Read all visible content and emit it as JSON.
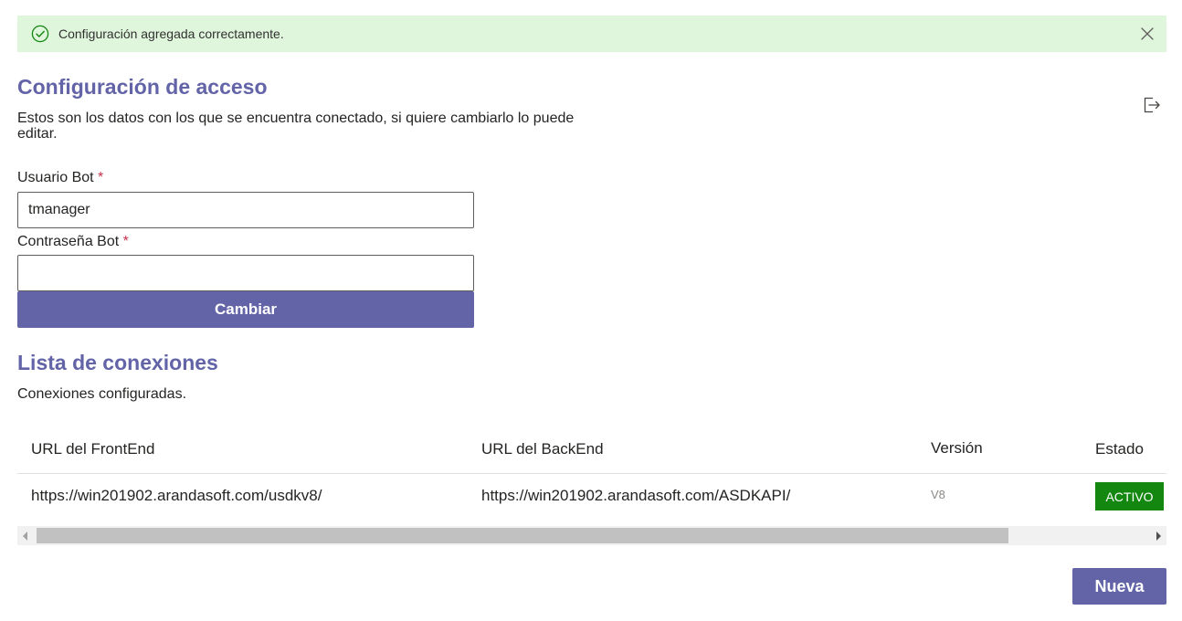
{
  "alert": {
    "message": "Configuración agregada correctamente.",
    "icon": "check-circle-icon",
    "close_icon": "close-icon"
  },
  "access": {
    "title": "Configuración de acceso",
    "description": "Estos son los datos con los que se encuentra conectado, si quiere cambiarlo lo puede editar.",
    "logout_icon": "sign-out-icon",
    "user_label": "Usuario Bot",
    "user_value": "tmanager",
    "password_label": "Contraseña Bot",
    "password_value": "",
    "required_mark": "*",
    "change_button": "Cambiar"
  },
  "connections": {
    "title": "Lista de conexiones",
    "subtitle": "Conexiones configuradas.",
    "columns": [
      "URL del FrontEnd",
      "URL del BackEnd",
      "Versión",
      "Estado"
    ],
    "rows": [
      {
        "frontend": "https://win201902.arandasoft.com/usdkv8/",
        "backend": "https://win201902.arandasoft.com/ASDKAPI/",
        "version": "V8",
        "status": "ACTIVO"
      }
    ],
    "new_button": "Nueva"
  },
  "colors": {
    "accent": "#6264a7",
    "success_bg": "#dff6dd",
    "success_icon": "#13870f",
    "status_active": "#13870f",
    "required": "#c4314b"
  }
}
